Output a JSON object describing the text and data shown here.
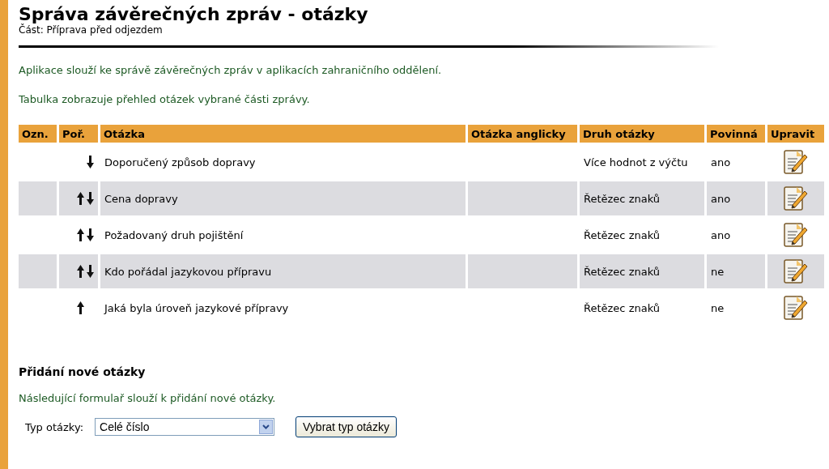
{
  "header": {
    "title": "Správa závěrečných zpráv - otázky",
    "subtitle": "Část: Příprava před odjezdem"
  },
  "intro": [
    "Aplikace slouží ke správě závěrečných zpráv v aplikacích zahraničního oddělení.",
    "Tabulka zobrazuje přehled otázek vybrané části zprávy."
  ],
  "table": {
    "columns": [
      "Ozn.",
      "Poř.",
      "Otázka",
      "Otázka anglicky",
      "Druh otázky",
      "Povinná",
      "Upravit"
    ],
    "rows": [
      {
        "can_move_up": false,
        "can_move_down": true,
        "question": "Doporučený způsob dopravy",
        "type": "Více hodnot z výčtu",
        "required": "ano"
      },
      {
        "can_move_up": true,
        "can_move_down": true,
        "question": "Cena dopravy",
        "type": "Řetězec znaků",
        "required": "ano"
      },
      {
        "can_move_up": true,
        "can_move_down": true,
        "question": "Požadovaný druh pojištění",
        "type": "Řetězec znaků",
        "required": "ano"
      },
      {
        "can_move_up": true,
        "can_move_down": true,
        "question": "Kdo pořádal jazykovou přípravu",
        "type": "Řetězec znaků",
        "required": "ne"
      },
      {
        "can_move_up": true,
        "can_move_down": false,
        "question": "Jaká byla úroveň jazykové přípravy",
        "type": "Řetězec znaků",
        "required": "ne"
      }
    ]
  },
  "add_section": {
    "heading": "Přidání nové otázky",
    "description": "Následující formulař slouží k přidání nové otázky.",
    "field_label": "Typ otázky:",
    "select_value": "Celé číslo",
    "button": "Vybrat typ otázky"
  }
}
